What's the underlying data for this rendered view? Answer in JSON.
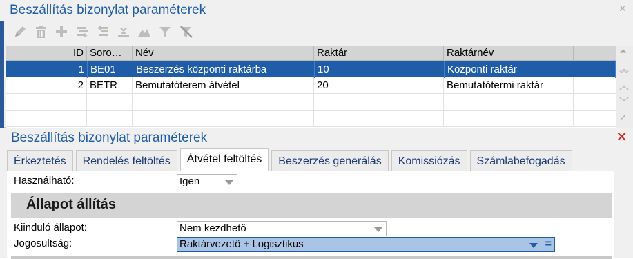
{
  "top_panel": {
    "title": "Beszállítás bizonylat paraméterek",
    "close_glyph": "×"
  },
  "toolbar": {
    "icons": [
      "pencil-icon",
      "trash-icon",
      "plus-icon",
      "copy-icon",
      "undo-icon",
      "export-icon",
      "chart-icon",
      "filter-icon",
      "clear-filter-icon"
    ]
  },
  "grid": {
    "columns": [
      "ID",
      "Soro…",
      "Név",
      "Raktár",
      "Raktárnév"
    ],
    "rows": [
      {
        "id": "1",
        "sor": "BE01",
        "nev": "Beszerzés központi raktárba",
        "raktar": "10",
        "raktarnev": "Központi raktár",
        "selected": true
      },
      {
        "id": "2",
        "sor": "BETR",
        "nev": "Bemutatóterem átvétel",
        "raktar": "20",
        "raktarnev": "Bemutatótermi raktár",
        "selected": false
      }
    ]
  },
  "bottom_panel": {
    "title": "Beszállítás bizonylat paraméterek",
    "close_glyph": "✕",
    "tabs": [
      {
        "label": "Érkeztetés",
        "active": false
      },
      {
        "label": "Rendelés feltöltés",
        "active": false
      },
      {
        "label": "Átvétel feltöltés",
        "active": true
      },
      {
        "label": "Beszerzés generálás",
        "active": false
      },
      {
        "label": "Komissiózás",
        "active": false
      },
      {
        "label": "Számlabefogadás",
        "active": false
      }
    ],
    "hasznalhato": {
      "label": "Használható:",
      "value": "Igen"
    },
    "section_title": "Állapot állítás",
    "kiindulo": {
      "label": "Kiinduló állapot:",
      "value": "Nem kezdhető"
    },
    "jogosultsag": {
      "label": "Jogosultság:",
      "value": "Raktárvezető + Logisztikus",
      "eq_glyph": "="
    }
  },
  "colors": {
    "accent": "#1f5da8",
    "selection": "#1f5da8",
    "header_gray": "#d4d4d4",
    "close_red": "#d42020"
  }
}
